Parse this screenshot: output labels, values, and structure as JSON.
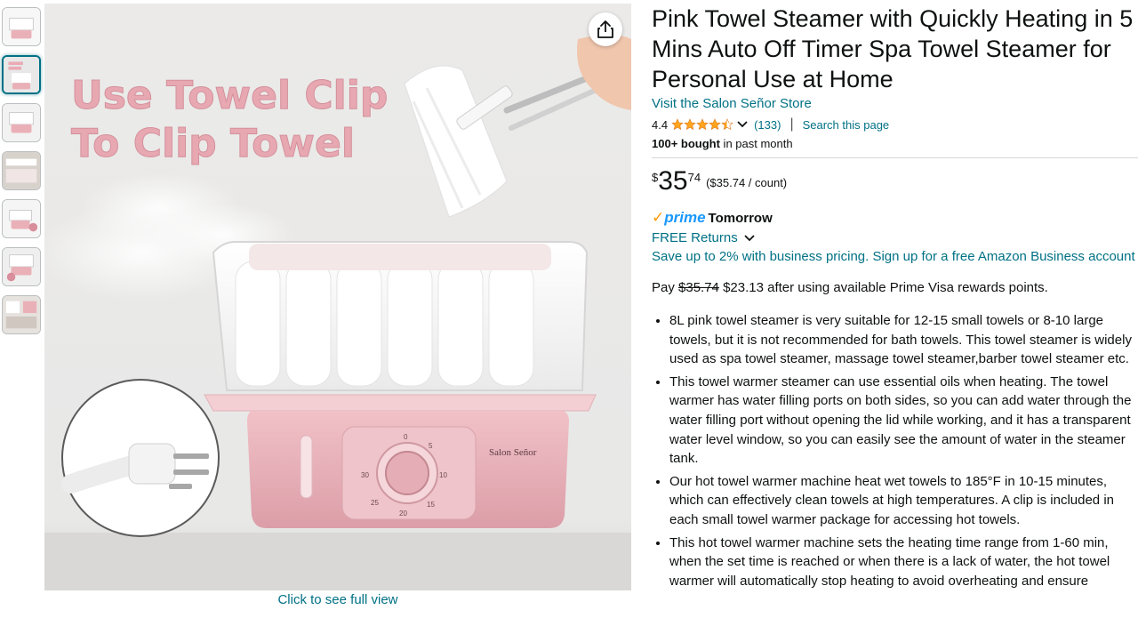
{
  "gallery": {
    "thumbnails": [
      "thumb-1",
      "thumb-2",
      "thumb-3",
      "thumb-4",
      "thumb-5",
      "thumb-6",
      "thumb-7"
    ],
    "active_index": 1,
    "overlay_text_line1": "Use Towel Clip",
    "overlay_text_line2": "To Clip Towel",
    "brand_on_device": "Salon Señor",
    "dial_numbers": [
      "0",
      "5",
      "10",
      "15",
      "20",
      "25",
      "30"
    ],
    "full_view_label": "Click to see full view",
    "share_icon": "share-icon"
  },
  "product": {
    "title": "Pink Towel Steamer with Quickly Heating in 5 Mins Auto Off Timer Spa Towel Steamer for Personal Use at Home",
    "store_link": "Visit the Salon Señor Store",
    "rating_value": "4.4",
    "rating_stars": 4.4,
    "rating_count": "(133)",
    "search_page": "Search this page",
    "bought_bold": "100+ bought",
    "bought_rest": " in past month"
  },
  "price": {
    "symbol": "$",
    "whole": "35",
    "fraction": "74",
    "unit": "($35.74 / count)"
  },
  "delivery": {
    "prime_label": "prime",
    "prime_day": "Tomorrow",
    "returns": "FREE Returns",
    "business": "Save up to 2% with business pricing. Sign up for a free Amazon Business account"
  },
  "visa": {
    "pay": "Pay ",
    "old_price": "$35.74",
    "rest": " $23.13 after using available Prime Visa rewards points."
  },
  "bullets": [
    "8L pink towel steamer is very suitable for 12-15 small towels or 8-10 large towels, but it is not recommended for bath towels. This towel steamer is widely used as spa towel steamer, massage towel steamer,barber towel steamer etc.",
    "This towel warmer steamer can use essential oils when heating. The towel warmer has water filling ports on both sides, so you can add water through the water filling port without opening the lid while working, and it has a transparent water level window, so you can easily see the amount of water in the steamer tank.",
    "Our hot towel warmer machine heat wet towels to 185°F in 10-15 minutes, which can effectively clean towels at high temperatures. A clip is included in each small towel warmer package for accessing hot towels.",
    "This hot towel warmer machine sets the heating time range from 1-60 min, when the set time is reached or when there is a lack of water, the hot towel warmer will automatically stop heating to avoid overheating and ensure"
  ],
  "colors": {
    "link": "#007185",
    "star": "#ffa41c",
    "prime_blue": "#1a98ff",
    "device_pink": "#eab0b8"
  }
}
